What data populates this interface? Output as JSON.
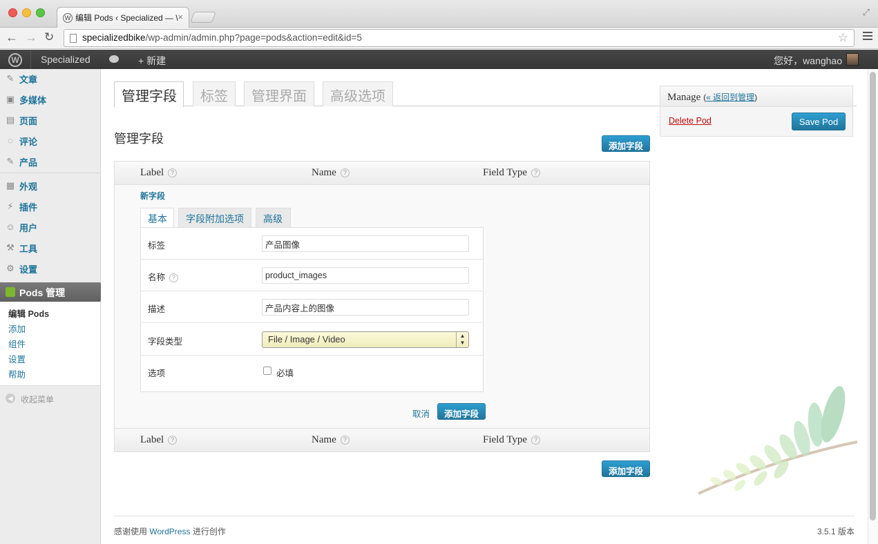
{
  "browser": {
    "tab_title": "编辑 Pods ‹ Specialized — \\",
    "favicon": "W",
    "url_host": "specializedbike",
    "url_path": "/wp-admin/admin.php?page=pods&action=edit&id=5"
  },
  "adminbar": {
    "site_name": "Specialized",
    "new_label": "新建",
    "howdy": "您好，wanghao"
  },
  "sidebar": {
    "items_top": [
      {
        "label": "文章",
        "icon": "pin-icon",
        "glyph": "✎"
      },
      {
        "label": "多媒体",
        "icon": "media-icon",
        "glyph": "▣"
      },
      {
        "label": "页面",
        "icon": "pages-icon",
        "glyph": "▤"
      },
      {
        "label": "评论",
        "icon": "comments-icon",
        "glyph": "◌"
      },
      {
        "label": "产品",
        "icon": "pin-icon",
        "glyph": "✎"
      }
    ],
    "items_bottom": [
      {
        "label": "外观",
        "icon": "appearance-icon",
        "glyph": "▦"
      },
      {
        "label": "插件",
        "icon": "plugins-icon",
        "glyph": "⚡"
      },
      {
        "label": "用户",
        "icon": "users-icon",
        "glyph": "☺"
      },
      {
        "label": "工具",
        "icon": "tools-icon",
        "glyph": "⚒"
      },
      {
        "label": "设置",
        "icon": "settings-icon",
        "glyph": "⚙"
      }
    ],
    "current": "Pods 管理",
    "submenu": [
      "编辑 Pods",
      "添加",
      "组件",
      "设置",
      "帮助"
    ],
    "collapse": "收起菜单"
  },
  "main": {
    "tabs": [
      "管理字段",
      "标签",
      "管理界面",
      "高级选项"
    ],
    "section_title": "管理字段",
    "add_field_button": "添加字段",
    "columns": {
      "label": "Label",
      "name": "Name",
      "field_type": "Field Type"
    },
    "new_field": "新字段",
    "subtabs": [
      "基本",
      "字段附加选项",
      "高级"
    ],
    "form": {
      "label_label": "标签",
      "label_value": "产品图像",
      "name_label": "名称",
      "name_value": "product_images",
      "desc_label": "描述",
      "desc_value": "产品内容上的图像",
      "type_label": "字段类型",
      "type_value": "File / Image / Video",
      "options_label": "选项",
      "required_label": "必填"
    },
    "cancel": "取消",
    "save_field_button": "添加字段"
  },
  "manage": {
    "title": "Manage",
    "back_link": "« 返回到管理",
    "delete": "Delete Pod",
    "save": "Save Pod"
  },
  "footer": {
    "thanks_prefix": "感谢使用 ",
    "wordpress": "WordPress",
    "thanks_suffix": " 进行创作",
    "version": "3.5.1 版本"
  },
  "colors": {
    "accent": "#21759b",
    "danger": "#bc0b0b",
    "adminbar": "#464646"
  }
}
